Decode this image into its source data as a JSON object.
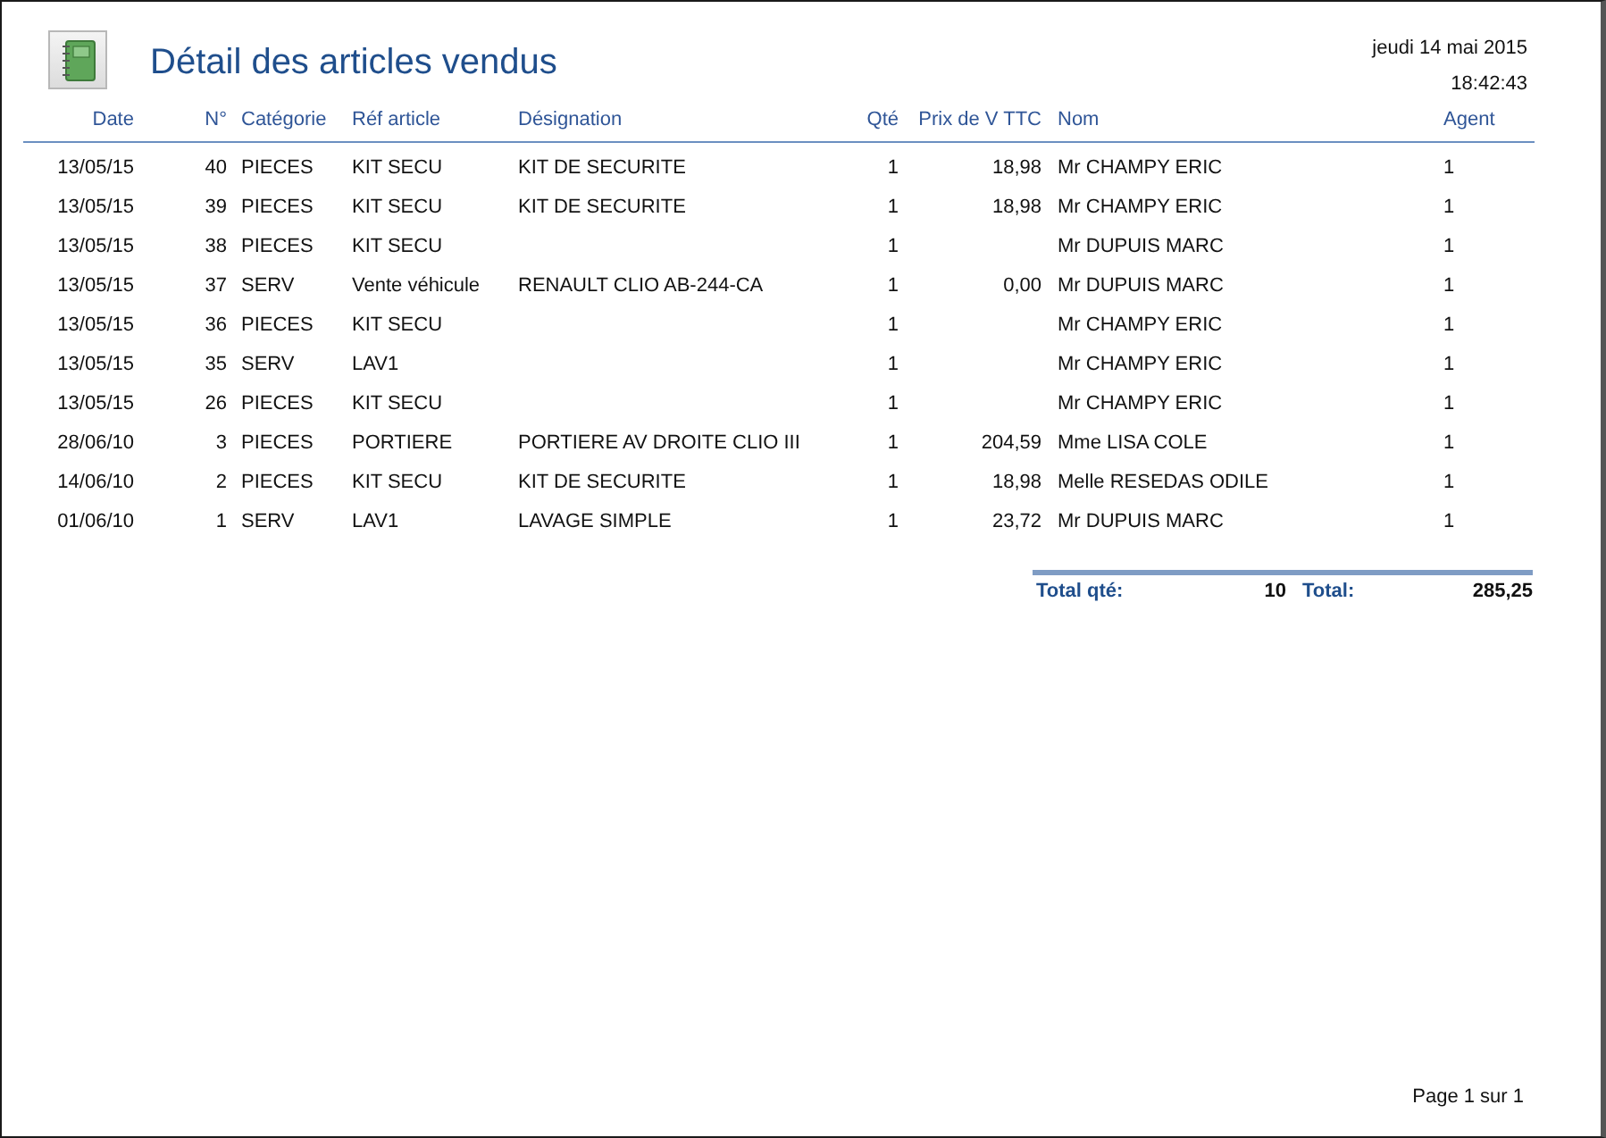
{
  "report": {
    "title": "Détail des articles vendus",
    "date": "jeudi 14 mai 2015",
    "time": "18:42:43"
  },
  "columns": [
    "Date",
    "N°",
    "Catégorie",
    "Réf article",
    "Désignation",
    "Qté",
    "Prix de V TTC",
    "Nom",
    "Agent"
  ],
  "rows": [
    [
      "13/05/15",
      "40",
      "PIECES",
      "KIT SECU",
      "KIT DE SECURITE",
      "1",
      "18,98",
      "Mr CHAMPY ERIC",
      "1"
    ],
    [
      "13/05/15",
      "39",
      "PIECES",
      "KIT SECU",
      "KIT DE SECURITE",
      "1",
      "18,98",
      "Mr CHAMPY ERIC",
      "1"
    ],
    [
      "13/05/15",
      "38",
      "PIECES",
      "KIT SECU",
      "",
      "1",
      "",
      "Mr DUPUIS MARC",
      "1"
    ],
    [
      "13/05/15",
      "37",
      "SERV",
      "Vente véhicule",
      "RENAULT CLIO AB-244-CA",
      "1",
      "0,00",
      "Mr DUPUIS MARC",
      "1"
    ],
    [
      "13/05/15",
      "36",
      "PIECES",
      "KIT SECU",
      "",
      "1",
      "",
      "Mr CHAMPY ERIC",
      "1"
    ],
    [
      "13/05/15",
      "35",
      "SERV",
      "LAV1",
      "",
      "1",
      "",
      "Mr CHAMPY ERIC",
      "1"
    ],
    [
      "13/05/15",
      "26",
      "PIECES",
      "KIT SECU",
      "",
      "1",
      "",
      "Mr CHAMPY ERIC",
      "1"
    ],
    [
      "28/06/10",
      "3",
      "PIECES",
      "PORTIERE",
      "PORTIERE AV DROITE CLIO III",
      "1",
      "204,59",
      "Mme LISA COLE",
      "1"
    ],
    [
      "14/06/10",
      "2",
      "PIECES",
      "KIT SECU",
      "KIT DE SECURITE",
      "1",
      "18,98",
      "Melle RESEDAS ODILE",
      "1"
    ],
    [
      "01/06/10",
      "1",
      "SERV",
      "LAV1",
      "LAVAGE SIMPLE",
      "1",
      "23,72",
      "Mr DUPUIS MARC",
      "1"
    ]
  ],
  "totals": {
    "qty_label": "Total qté:",
    "qty": "10",
    "total_label": "Total:",
    "total": "285,25"
  },
  "footer": {
    "page": "Page 1 sur 1"
  }
}
